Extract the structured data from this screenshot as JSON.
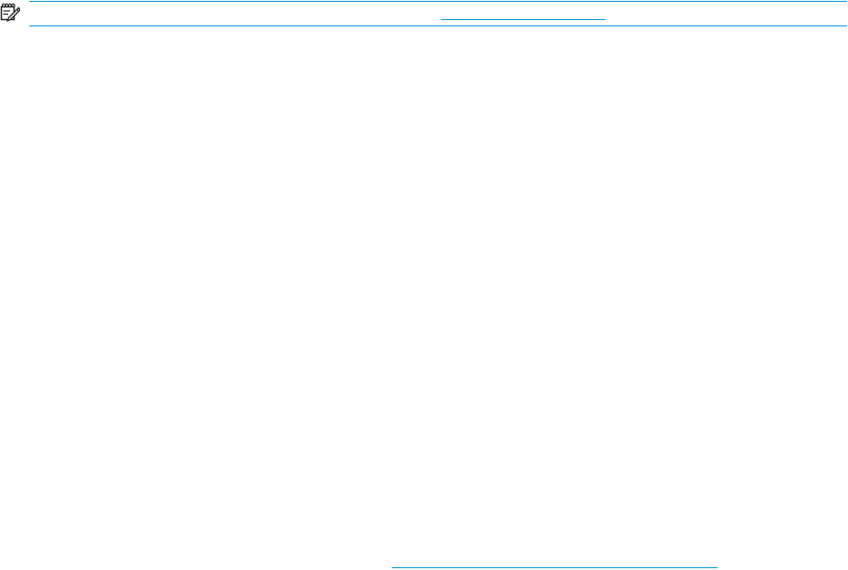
{
  "note": {
    "icon": "note-icon",
    "link_text": ""
  },
  "footer": {
    "link_text": ""
  },
  "colors": {
    "accent": "#0096d6",
    "icon": "#222222",
    "background": "#ffffff"
  }
}
